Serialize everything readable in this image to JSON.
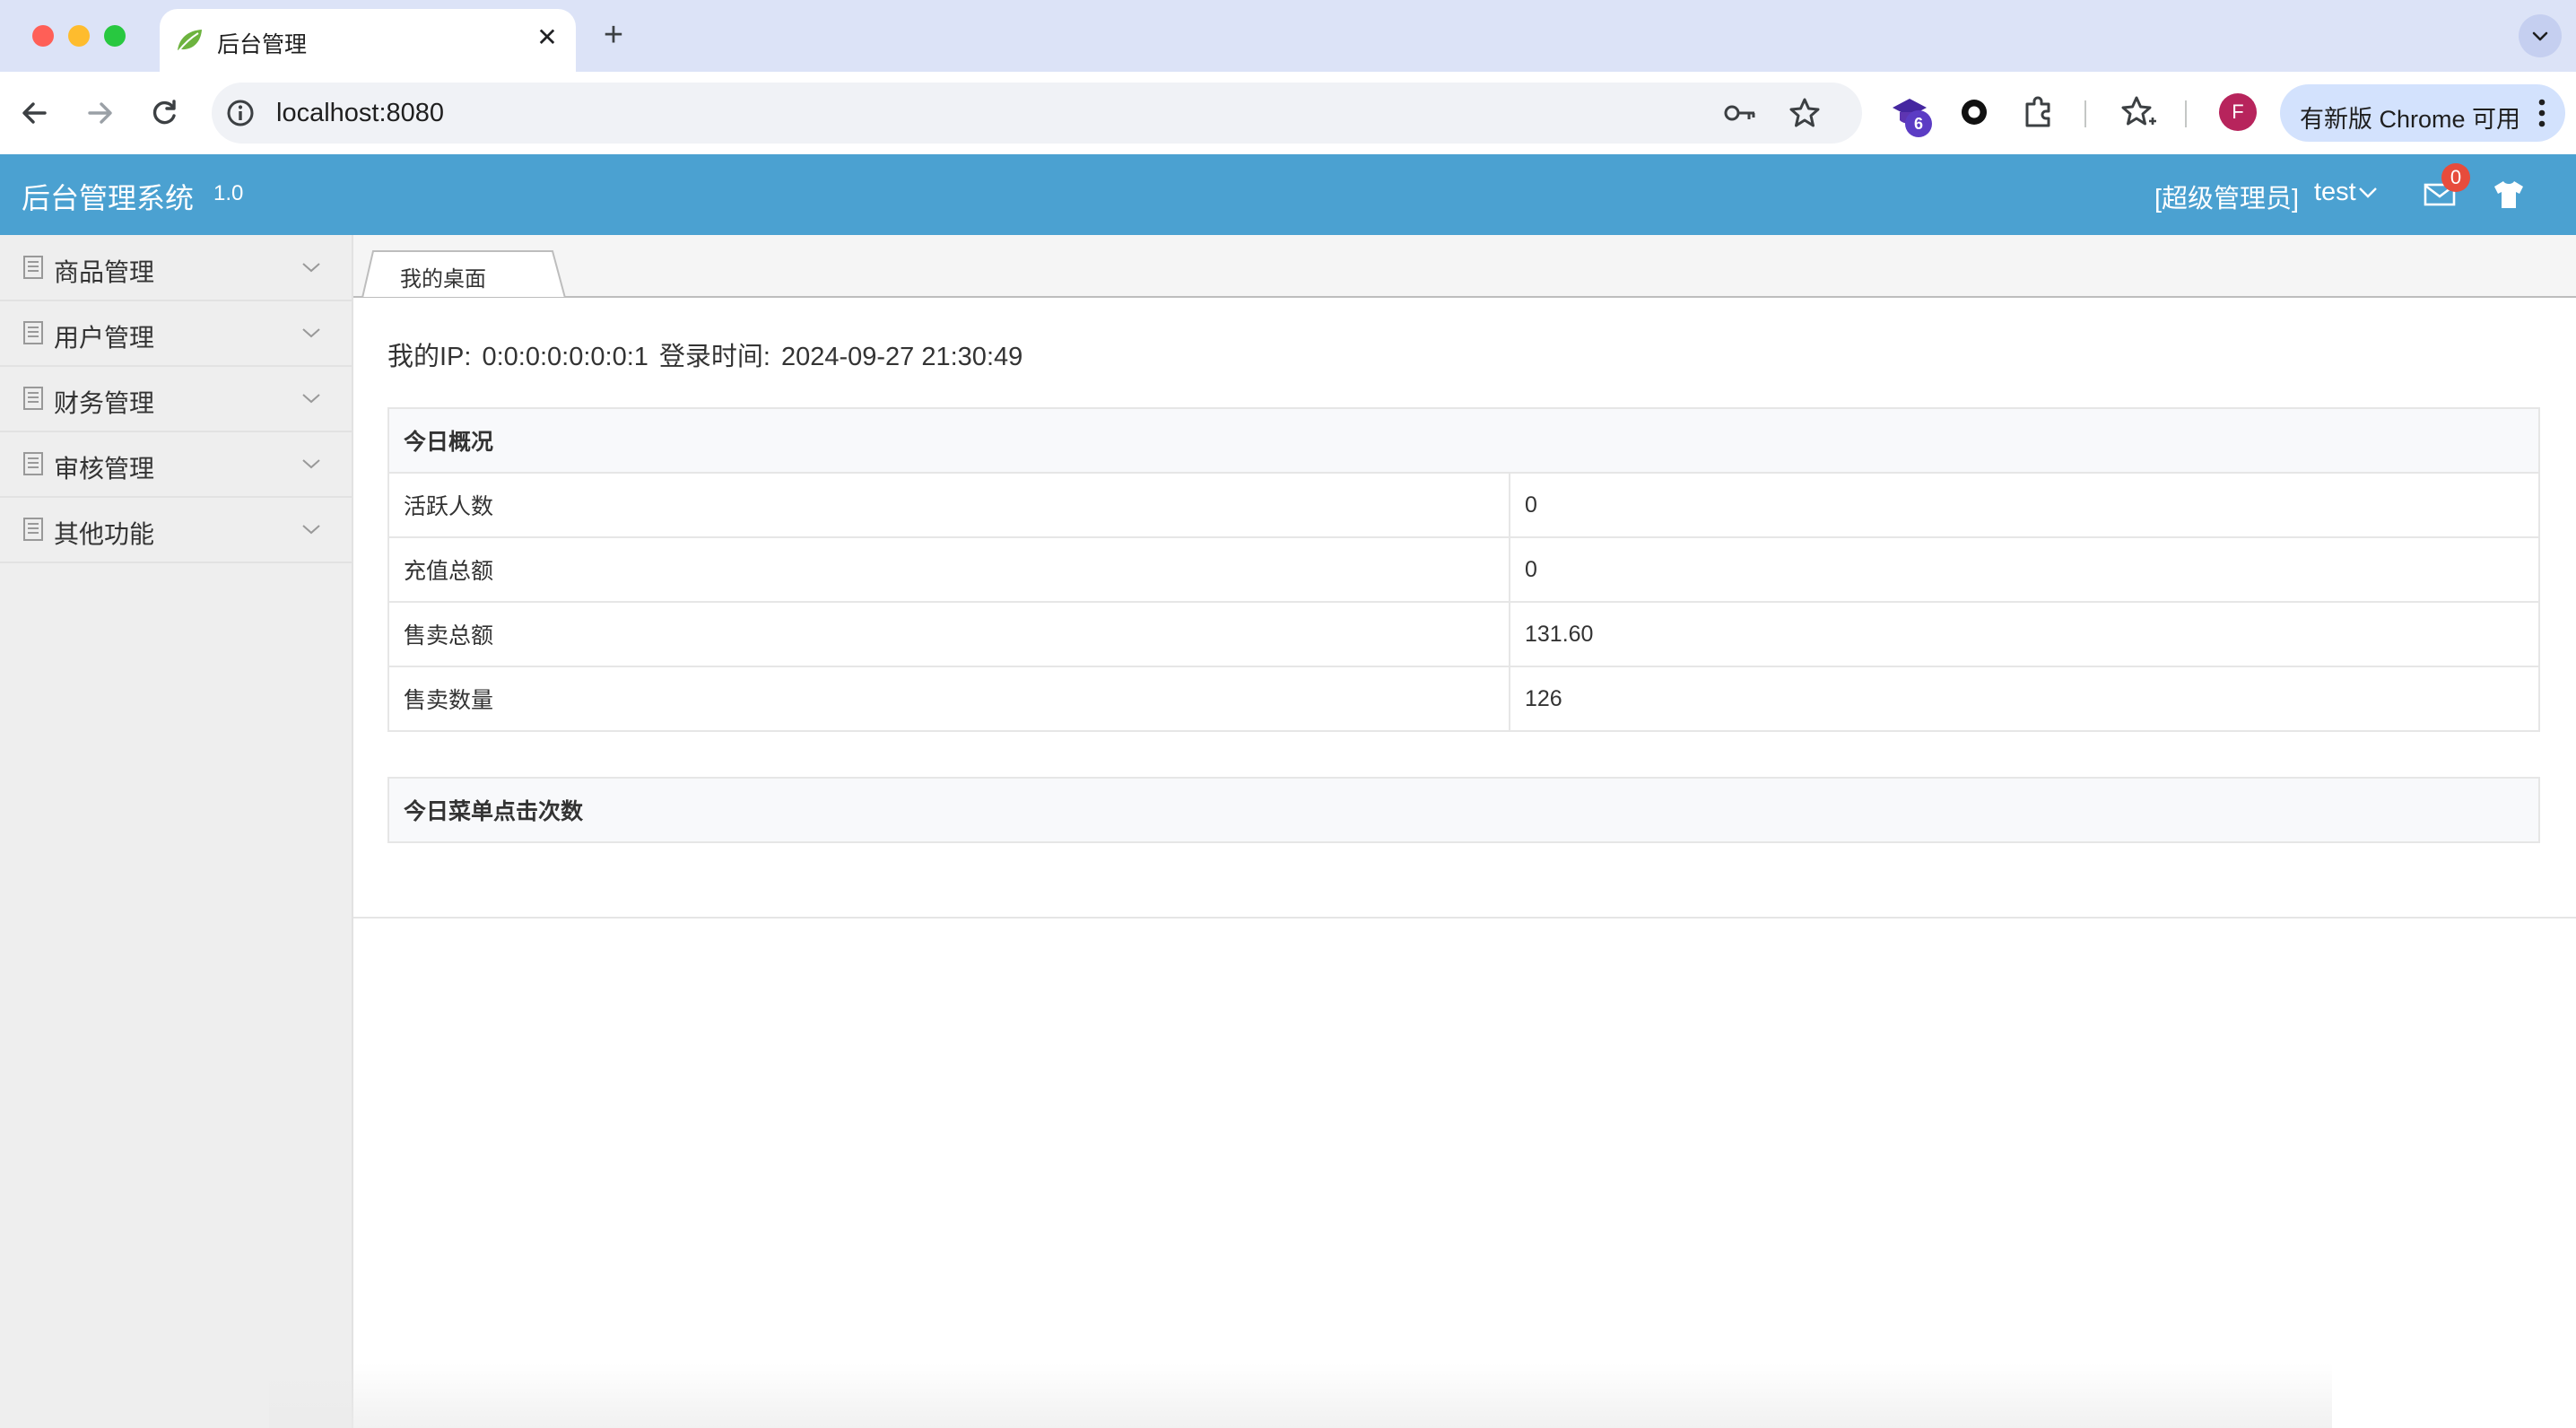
{
  "browser": {
    "tab_title": "后台管理",
    "url": "localhost:8080",
    "extension_badge": "6",
    "profile_initial": "F",
    "update_label": "有新版 Chrome 可用"
  },
  "header": {
    "title": "后台管理系统",
    "version": "1.0",
    "role": "[超级管理员]",
    "username": "test",
    "mail_count": "0"
  },
  "sidebar": {
    "items": [
      {
        "label": "商品管理"
      },
      {
        "label": "用户管理"
      },
      {
        "label": "财务管理"
      },
      {
        "label": "审核管理"
      },
      {
        "label": "其他功能"
      }
    ]
  },
  "tabs": [
    {
      "label": "我的桌面"
    }
  ],
  "main": {
    "ip_label": "我的IP:",
    "ip_value": "0:0:0:0:0:0:0:1",
    "login_label": "登录时间:",
    "login_time": "2024-09-27 21:30:49",
    "overview_title": "今日概况",
    "overview_rows": [
      {
        "label": "活跃人数",
        "value": "0"
      },
      {
        "label": "充值总额",
        "value": "0"
      },
      {
        "label": "售卖总额",
        "value": "131.60"
      },
      {
        "label": "售卖数量",
        "value": "126"
      }
    ],
    "clicks_title": "今日菜单点击次数"
  },
  "colors": {
    "header_bg": "#4ba1d1",
    "sidebar_bg": "#eeeeee",
    "badge_red": "#e74c3c"
  }
}
